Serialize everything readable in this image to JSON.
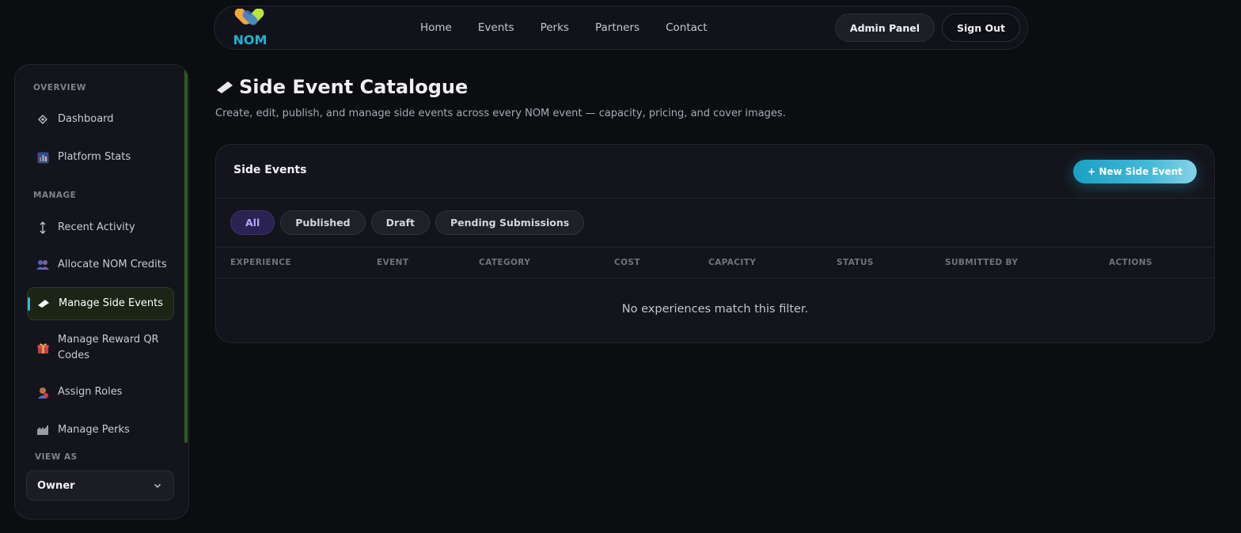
{
  "topnav": {
    "logo_text": "NOM",
    "links": [
      "Home",
      "Events",
      "Perks",
      "Partners",
      "Contact"
    ],
    "admin_label": "Admin Panel",
    "signout_label": "Sign Out"
  },
  "sidebar": {
    "section_overview": "OVERVIEW",
    "section_manage": "MANAGE",
    "section_view_as": "VIEW AS",
    "items": [
      {
        "label": "Dashboard",
        "icon": "diamond-icon"
      },
      {
        "label": "Platform Stats",
        "icon": "bar-chart-icon"
      },
      {
        "label": "Recent Activity",
        "icon": "up-down-arrow-icon"
      },
      {
        "label": "Allocate NOM Credits",
        "icon": "users-icon"
      },
      {
        "label": "Manage Side Events",
        "icon": "ticket-icon"
      },
      {
        "label": "Manage Reward QR Codes",
        "icon": "gift-icon"
      },
      {
        "label": "Assign Roles",
        "icon": "person-icon"
      },
      {
        "label": "Manage Perks",
        "icon": "factory-icon"
      }
    ],
    "view_as_value": "Owner"
  },
  "main": {
    "title": "Side Event Catalogue",
    "description": "Create, edit, publish, and manage side events across every NOM event — capacity, pricing, and cover images."
  },
  "card": {
    "title": "Side Events",
    "new_button": "+ New Side Event",
    "filters": [
      "All",
      "Published",
      "Draft",
      "Pending Submissions"
    ],
    "columns": [
      "EXPERIENCE",
      "EVENT",
      "CATEGORY",
      "COST",
      "CAPACITY",
      "STATUS",
      "SUBMITTED BY",
      "ACTIONS"
    ],
    "empty_message": "No experiences match this filter."
  },
  "colors": {
    "accent": "#3bb4d6",
    "active_chip": "#b9a6ff",
    "background": "#0c0d11"
  }
}
